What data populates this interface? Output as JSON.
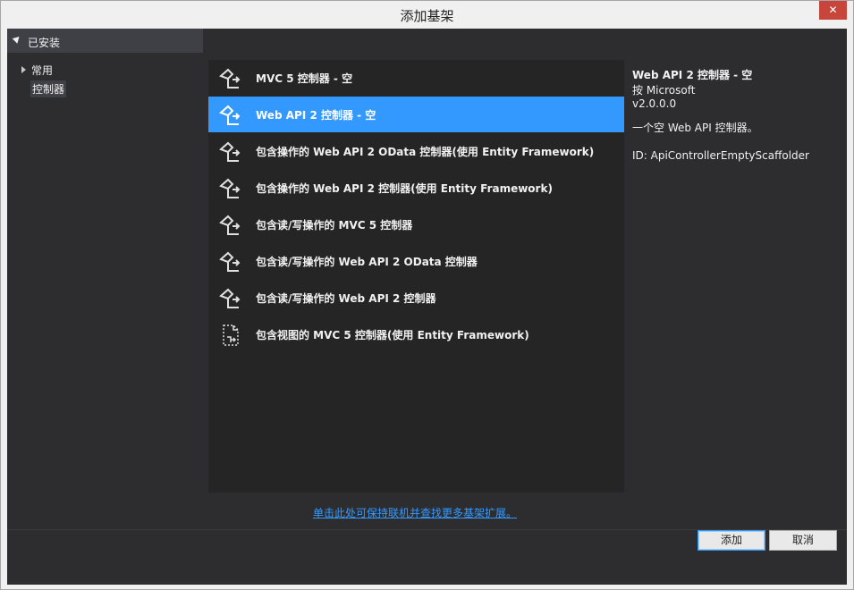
{
  "window": {
    "title": "添加基架",
    "close_label": "✕"
  },
  "tree": {
    "header": "已安装",
    "items": [
      {
        "label": "常用"
      },
      {
        "label": "控制器"
      }
    ]
  },
  "list": {
    "items": [
      {
        "label": "MVC 5 控制器 - 空",
        "icon": "controller-icon",
        "selected": false
      },
      {
        "label": "Web API 2 控制器 - 空",
        "icon": "controller-icon",
        "selected": true
      },
      {
        "label": "包含操作的 Web API 2 OData 控制器(使用 Entity Framework)",
        "icon": "controller-icon",
        "selected": false
      },
      {
        "label": "包含操作的 Web API 2 控制器(使用 Entity Framework)",
        "icon": "controller-icon",
        "selected": false
      },
      {
        "label": "包含读/写操作的 MVC 5 控制器",
        "icon": "controller-icon",
        "selected": false
      },
      {
        "label": "包含读/写操作的 Web API 2 OData 控制器",
        "icon": "controller-icon",
        "selected": false
      },
      {
        "label": "包含读/写操作的 Web API 2 控制器",
        "icon": "controller-icon",
        "selected": false
      },
      {
        "label": "包含视图的 MVC 5 控制器(使用 Entity Framework)",
        "icon": "view-controller-icon",
        "selected": false
      }
    ]
  },
  "details": {
    "title": "Web API 2 控制器 - 空",
    "author": "按 Microsoft",
    "version": "v2.0.0.0",
    "description": "一个空 Web API 控制器。",
    "id": "ID: ApiControllerEmptyScaffolder"
  },
  "online_link": "单击此处可保持联机并查找更多基架扩展。",
  "buttons": {
    "add": "添加",
    "cancel": "取消"
  },
  "colors": {
    "accent": "#3399ff",
    "background": "#2d2d30",
    "list_background": "#252526",
    "close_button": "#c7453a"
  }
}
